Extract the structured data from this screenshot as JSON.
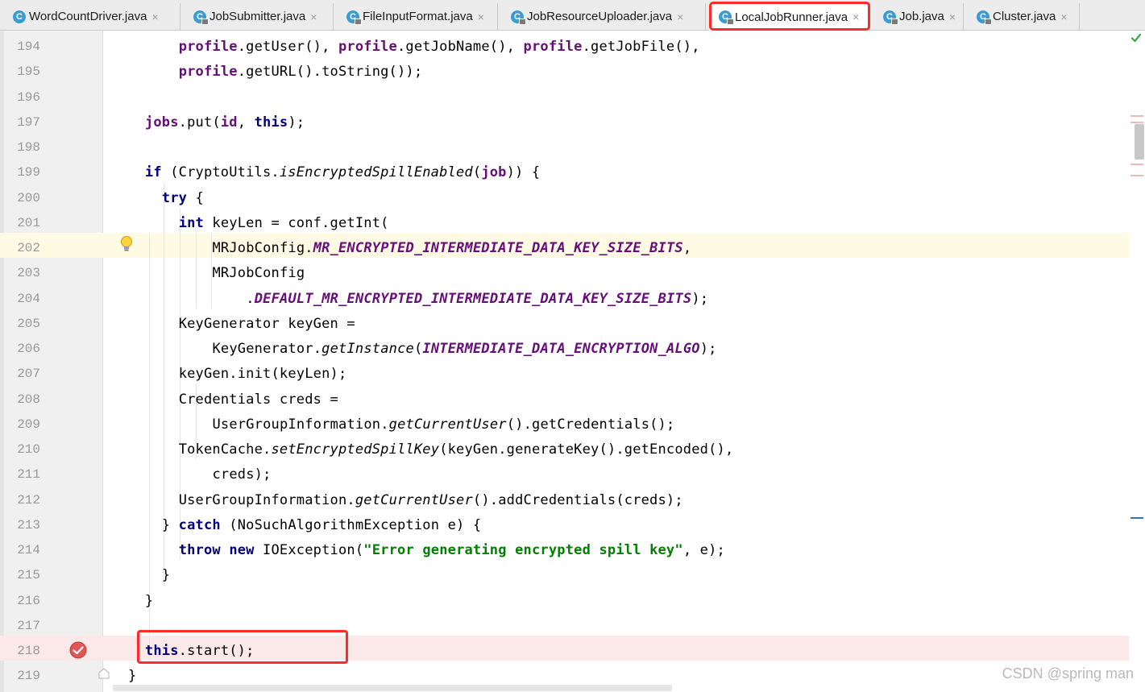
{
  "tabs": [
    {
      "label": "WordCountDriver.java",
      "icon": "class-icon",
      "locked": false,
      "active": false
    },
    {
      "label": "JobSubmitter.java",
      "icon": "class-icon",
      "locked": true,
      "active": false
    },
    {
      "label": "FileInputFormat.java",
      "icon": "class-icon",
      "locked": true,
      "active": false
    },
    {
      "label": "JobResourceUploader.java",
      "icon": "class-icon",
      "locked": true,
      "active": false
    },
    {
      "label": "LocalJobRunner.java",
      "icon": "class-icon",
      "locked": true,
      "active": true
    },
    {
      "label": "Job.java",
      "icon": "class-icon",
      "locked": true,
      "active": false
    },
    {
      "label": "Cluster.java",
      "icon": "class-icon",
      "locked": true,
      "active": false
    }
  ],
  "tab_close_glyph": "×",
  "class_icon_letter": "C",
  "editor": {
    "line_numbers": [
      "194",
      "195",
      "196",
      "197",
      "198",
      "199",
      "200",
      "201",
      "202",
      "203",
      "204",
      "205",
      "206",
      "207",
      "208",
      "209",
      "210",
      "211",
      "212",
      "213",
      "214",
      "215",
      "216",
      "217",
      "218",
      "219"
    ],
    "caret_line": "202",
    "breakpoint_line": "218",
    "lines": [
      [
        {
          "t": "profile",
          "c": "fld"
        },
        {
          "t": ".getUser(), "
        },
        {
          "t": "profile",
          "c": "fld"
        },
        {
          "t": ".getJobName(), "
        },
        {
          "t": "profile",
          "c": "fld"
        },
        {
          "t": ".getJobFile(),"
        }
      ],
      [
        {
          "t": "profile",
          "c": "fld"
        },
        {
          "t": ".getURL().toString());"
        }
      ],
      [],
      [
        {
          "t": "jobs",
          "c": "fld"
        },
        {
          "t": ".put("
        },
        {
          "t": "id",
          "c": "fld"
        },
        {
          "t": ", "
        },
        {
          "t": "this",
          "c": "kw"
        },
        {
          "t": ");"
        }
      ],
      [],
      [
        {
          "t": "if",
          "c": "kw"
        },
        {
          "t": " (CryptoUtils."
        },
        {
          "t": "isEncryptedSpillEnabled",
          "c": "sm"
        },
        {
          "t": "("
        },
        {
          "t": "job",
          "c": "fld"
        },
        {
          "t": ")) {"
        }
      ],
      [
        {
          "t": "try",
          "c": "kw"
        },
        {
          "t": " {"
        }
      ],
      [
        {
          "t": "int",
          "c": "kw"
        },
        {
          "t": " keyLen = conf.getInt("
        }
      ],
      [
        {
          "t": "MRJobConfig."
        },
        {
          "t": "MR_ENCRYPTED_INTERMEDIATE_DATA_KEY_SIZE_BITS",
          "c": "cst"
        },
        {
          "t": ","
        }
      ],
      [
        {
          "t": "MRJobConfig"
        }
      ],
      [
        {
          "t": "."
        },
        {
          "t": "DEFAULT_MR_ENCRYPTED_INTERMEDIATE_DATA_KEY_SIZE_BITS",
          "c": "cst"
        },
        {
          "t": ");"
        }
      ],
      [
        {
          "t": "KeyGenerator keyGen ="
        }
      ],
      [
        {
          "t": "KeyGenerator."
        },
        {
          "t": "getInstance",
          "c": "sm"
        },
        {
          "t": "("
        },
        {
          "t": "INTERMEDIATE_DATA_ENCRYPTION_ALGO",
          "c": "cst"
        },
        {
          "t": ");"
        }
      ],
      [
        {
          "t": "keyGen.init(keyLen);"
        }
      ],
      [
        {
          "t": "Credentials creds ="
        }
      ],
      [
        {
          "t": "UserGroupInformation."
        },
        {
          "t": "getCurrentUser",
          "c": "sm"
        },
        {
          "t": "().getCredentials();"
        }
      ],
      [
        {
          "t": "TokenCache."
        },
        {
          "t": "setEncryptedSpillKey",
          "c": "sm"
        },
        {
          "t": "(keyGen.generateKey().getEncoded(),"
        }
      ],
      [
        {
          "t": "creds);"
        }
      ],
      [
        {
          "t": "UserGroupInformation."
        },
        {
          "t": "getCurrentUser",
          "c": "sm"
        },
        {
          "t": "().addCredentials(creds);"
        }
      ],
      [
        {
          "t": "} "
        },
        {
          "t": "catch",
          "c": "kw"
        },
        {
          "t": " (NoSuchAlgorithmException e) {"
        }
      ],
      [
        {
          "t": "throw",
          "c": "kw"
        },
        {
          "t": " "
        },
        {
          "t": "new",
          "c": "kw"
        },
        {
          "t": " IOException("
        },
        {
          "t": "\"Error generating encrypted spill key\"",
          "c": "str"
        },
        {
          "t": ", e);"
        }
      ],
      [
        {
          "t": "}"
        }
      ],
      [
        {
          "t": "}"
        }
      ],
      [],
      [
        {
          "t": "this",
          "c": "kw"
        },
        {
          "t": ".start();"
        }
      ],
      [
        {
          "t": "}"
        }
      ]
    ]
  },
  "icons": {
    "intention": "lightbulb-icon",
    "breakpoint": "breakpoint-check-icon",
    "inspection_ok": "check-icon",
    "fold": "fold-icon"
  },
  "colors": {
    "keyword": "#000080",
    "field": "#660e7a",
    "string": "#008000",
    "highlight_box": "#ff2a2a",
    "caret_row": "#fffae3",
    "breakpoint_row": "#fbe9e9"
  },
  "watermark": "CSDN @spring man"
}
